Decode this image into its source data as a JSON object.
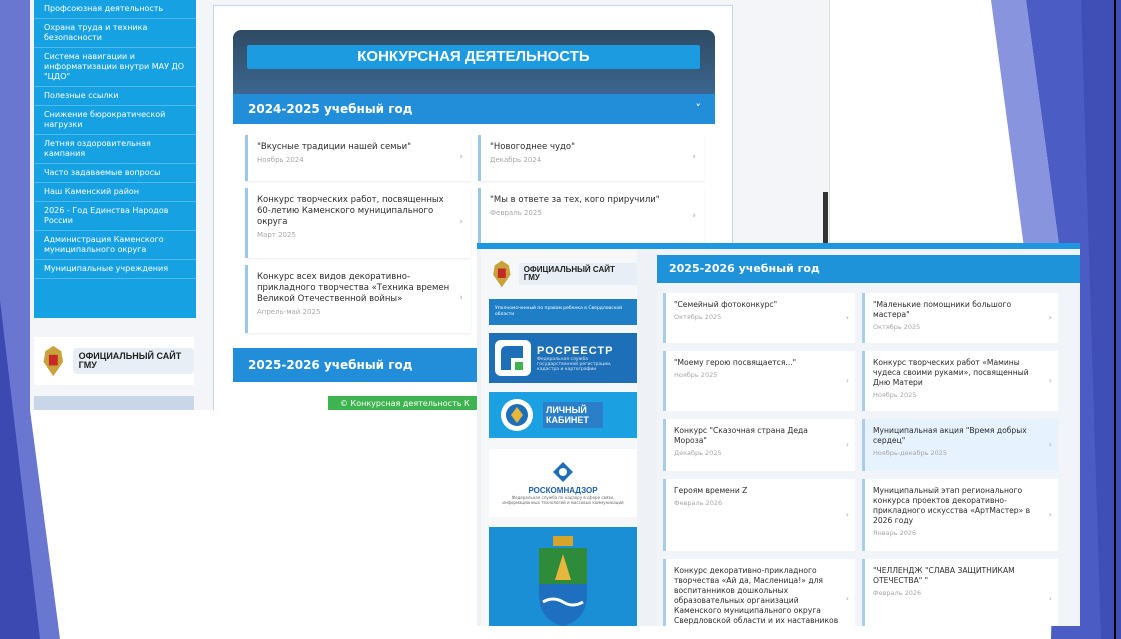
{
  "nav": {
    "items": [
      "Профсоюзная деятельность",
      "Охрана труда и техника безопасности",
      "Система навигации и информатизации внутри МАУ ДО \"ЦДО\"",
      "Полезные ссылки",
      "Снижение бюрократической нагрузки",
      "Летняя оздоровительная кампания",
      "Часто задаваемые вопросы",
      "Наш Каменский район",
      "2026 - Год Единства Народов России",
      "Администрация Каменского муниципального округа",
      "Муниципальные учреждения"
    ]
  },
  "logos": {
    "gmu": "ОФИЦИАЛЬНЫЙ САЙТ ГМУ",
    "rosreestr": "РОСРЕЕСТР",
    "rosreestr_sub": "Федеральная служба государственной регистрации, кадастра и картографии",
    "lk": "ЛИЧНЫЙ КАБИНЕТ",
    "rkn": "РОСКОМНАДЗОР",
    "rkn_sub": "Федеральная служба по надзору в сфере связи, информационных технологий и массовых коммуникаций",
    "region_banner": "Уполномоченный по правам ребенка в Свердловской области"
  },
  "section": {
    "title": "КОНКУРСНАЯ ДЕЯТЕЛЬНОСТЬ",
    "year1": "2024-2025 учебный год",
    "year2": "2025-2026 учебный год",
    "footer_link": "© Конкурсная деятельность К"
  },
  "cards_2024": [
    {
      "title": "\"Вкусные традиции нашей семьи\"",
      "date": "Ноябрь 2024"
    },
    {
      "title": "\"Новогоднее чудо\"",
      "date": "Декабрь 2024"
    },
    {
      "title": "Конкурс творческих работ, посвященных 60-летию Каменского муниципального округа",
      "date": "Март 2025"
    },
    {
      "title": "\"Мы в ответе за тех, кого приручили\"",
      "date": "Февраль 2025"
    },
    {
      "title": "Конкурс всех видов декоративно-прикладного творчества «Техника времен Великой Отечественной войны»",
      "date": "Апрель-май 2025"
    }
  ],
  "cards_2025": [
    {
      "title": "\"Семейный фотоконкурс\"",
      "date": "Октябрь 2025"
    },
    {
      "title": "\"Маленькие помощники большого мастера\"",
      "date": "Октябрь 2025"
    },
    {
      "title": "\"Моему герою посвящается...\"",
      "date": "Ноябрь 2025"
    },
    {
      "title": "Конкурс творческих работ «Мамины чудеса своими руками», посвященный Дню Матери",
      "date": "Ноябрь 2025"
    },
    {
      "title": "Конкурс \"Сказочная страна Деда Мороза\"",
      "date": "Декабрь 2025"
    },
    {
      "title": "Муниципальная акция \"Время добрых сердец\"",
      "date": "Ноябрь-декабрь 2025"
    },
    {
      "title": "Героям времени Z",
      "date": "Февраль 2026"
    },
    {
      "title": "Муниципальный этап регионального конкурса проектов декоративно-прикладного искусства «АртМастер» в 2026 году",
      "date": "Январь 2026"
    },
    {
      "title": "Конкурс декоративно-прикладного творчества «Ай да, Масленица!» для воспитанников дошкольных образовательных организаций Каменского муниципального округа Свердловской области и их наставников",
      "date": ""
    },
    {
      "title": "\"ЧЕЛЛЕНДЖ \"СЛАВА ЗАЩИТНИКАМ ОТЕЧЕСТВА\" \"",
      "date": "Февраль 2026"
    }
  ],
  "ui": {
    "arrow": "›",
    "chevron": "˅"
  }
}
